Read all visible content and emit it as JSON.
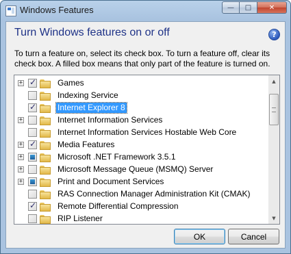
{
  "window": {
    "title": "Windows Features",
    "controls": {
      "minimize": "—",
      "maximize": "□",
      "close": "✕"
    }
  },
  "dialog": {
    "heading": "Turn Windows features on or off",
    "help": "?",
    "description": "To turn a feature on, select its check box. To turn a feature off, clear its check box. A filled box means that only part of the feature is turned on."
  },
  "features": [
    {
      "label": "Games",
      "expandable": true,
      "state": "checked",
      "selected": false
    },
    {
      "label": "Indexing Service",
      "expandable": false,
      "state": "unchecked",
      "selected": false
    },
    {
      "label": "Internet Explorer 8",
      "expandable": false,
      "state": "checked",
      "selected": true
    },
    {
      "label": "Internet Information Services",
      "expandable": true,
      "state": "unchecked",
      "selected": false
    },
    {
      "label": "Internet Information Services Hostable Web Core",
      "expandable": false,
      "state": "unchecked",
      "selected": false
    },
    {
      "label": "Media Features",
      "expandable": true,
      "state": "checked",
      "selected": false
    },
    {
      "label": "Microsoft .NET Framework 3.5.1",
      "expandable": true,
      "state": "partial",
      "selected": false
    },
    {
      "label": "Microsoft Message Queue (MSMQ) Server",
      "expandable": true,
      "state": "unchecked",
      "selected": false
    },
    {
      "label": "Print and Document Services",
      "expandable": true,
      "state": "partial",
      "selected": false
    },
    {
      "label": "RAS Connection Manager Administration Kit (CMAK)",
      "expandable": false,
      "state": "unchecked",
      "selected": false
    },
    {
      "label": "Remote Differential Compression",
      "expandable": false,
      "state": "checked",
      "selected": false
    },
    {
      "label": "RIP Listener",
      "expandable": false,
      "state": "unchecked",
      "selected": false
    }
  ],
  "buttons": {
    "ok": "OK",
    "cancel": "Cancel"
  },
  "colors": {
    "heading": "#1e3287",
    "selection": "#3399ff",
    "frame": "#a9c3e0"
  }
}
